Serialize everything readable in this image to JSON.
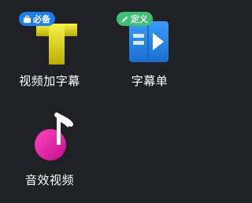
{
  "tiles": [
    {
      "label": "视频加字幕",
      "badge": {
        "text": "必备",
        "icon": "briefcase-icon",
        "color": "#1e7df0"
      },
      "icon": "subtitle-t-icon",
      "colors": [
        "#f5ec2a",
        "#c3b908"
      ]
    },
    {
      "label": "字幕单",
      "badge": {
        "text": "定义",
        "icon": "pencil-icon",
        "color": "#3fbf76"
      },
      "icon": "subtitle-list-icon",
      "colors": [
        "#2d8cf0",
        "#1565c0"
      ]
    },
    {
      "label": "音效视频",
      "icon": "music-note-icon",
      "colors": [
        "#ff3db0",
        "#c51192"
      ]
    }
  ]
}
